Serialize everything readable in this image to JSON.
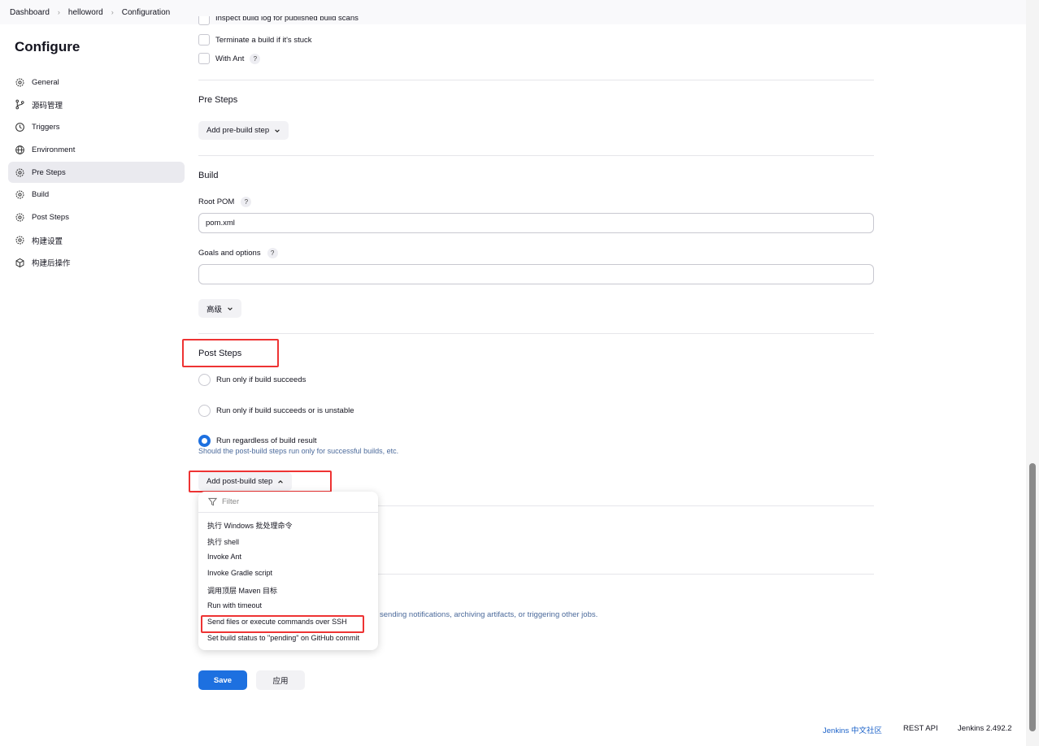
{
  "breadcrumb": [
    "Dashboard",
    "helloword",
    "Configuration"
  ],
  "page_title": "Configure",
  "sidebar": {
    "items": [
      {
        "label": "General",
        "icon": "gear-icon"
      },
      {
        "label": "源码管理",
        "icon": "branch-icon"
      },
      {
        "label": "Triggers",
        "icon": "clock-icon"
      },
      {
        "label": "Environment",
        "icon": "globe-icon"
      },
      {
        "label": "Pre Steps",
        "icon": "gear-icon"
      },
      {
        "label": "Build",
        "icon": "gear-icon"
      },
      {
        "label": "Post Steps",
        "icon": "gear-icon"
      },
      {
        "label": "构建设置",
        "icon": "gear-icon"
      },
      {
        "label": "构建后操作",
        "icon": "package-icon"
      }
    ]
  },
  "env_options": {
    "partial": "Inspect build log for published build scans",
    "terminate": "Terminate a build if it's stuck",
    "with_ant": "With Ant"
  },
  "pre_steps": {
    "title": "Pre Steps",
    "add_button": "Add pre-build step"
  },
  "build": {
    "title": "Build",
    "root_pom_label": "Root POM",
    "root_pom_value": "pom.xml",
    "goals_label": "Goals and options",
    "goals_value": "",
    "advanced_button": "高级"
  },
  "post_steps": {
    "title": "Post Steps",
    "radio_1": "Run only if build succeeds",
    "radio_2": "Run only if build succeeds or is unstable",
    "radio_3": "Run regardless of build result",
    "hint": "Should the post-build steps run only for successful builds, etc.",
    "add_button": "Add post-build step"
  },
  "post_build_hint_fragment": "sending notifications, archiving artifacts, or triggering other jobs.",
  "dropdown": {
    "filter_placeholder": "Filter",
    "items": [
      "执行 Windows 批处理命令",
      "执行 shell",
      "Invoke Ant",
      "Invoke Gradle script",
      "调用顶层 Maven 目标",
      "Run with timeout",
      "Send files or execute commands over SSH",
      "Set build status to \"pending\" on GitHub commit"
    ]
  },
  "actions": {
    "save": "Save",
    "apply": "应用"
  },
  "footer": {
    "community": "Jenkins 中文社区",
    "rest_api": "REST API",
    "version": "Jenkins 2.492.2"
  },
  "colors": {
    "accent": "#1d70e0",
    "highlight_box": "#e33333"
  }
}
